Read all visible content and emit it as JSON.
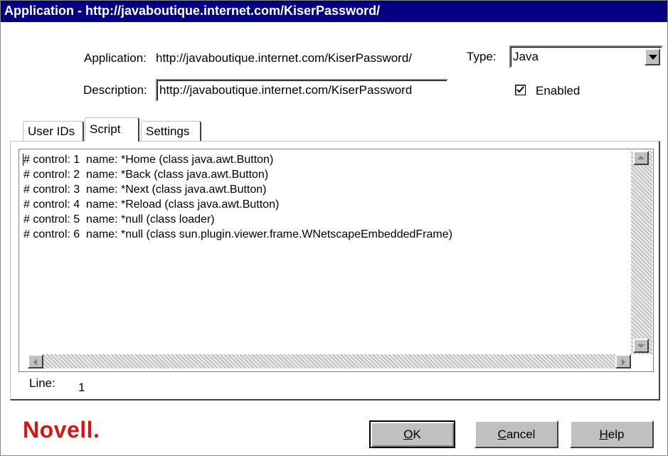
{
  "window": {
    "title": "Application - http://javaboutique.internet.com/KiserPassword/"
  },
  "form": {
    "application_label": "Application:",
    "application_value": "http://javaboutique.internet.com/KiserPassword/",
    "type_label": "Type:",
    "type_value": "Java",
    "description_label": "Description:",
    "description_value": "http://javaboutique.internet.com/KiserPassword",
    "enabled_label": "Enabled",
    "enabled_checked": true
  },
  "tabs": [
    {
      "label": "User IDs",
      "active": false
    },
    {
      "label": "Script",
      "active": true
    },
    {
      "label": "Settings",
      "active": false
    }
  ],
  "script": {
    "lines": [
      "# control: 1  name: *Home (class java.awt.Button)",
      "# control: 2  name: *Back (class java.awt.Button)",
      "# control: 3  name: *Next (class java.awt.Button)",
      "# control: 4  name: *Reload (class java.awt.Button)",
      "# control: 5  name: *null (class loader)",
      "# control: 6  name: *null (class sun.plugin.viewer.frame.WNetscapeEmbeddedFrame)"
    ],
    "line_label": "Line:",
    "line_value": "1"
  },
  "buttons": {
    "ok_prefix": "O",
    "ok_rest": "K",
    "cancel_prefix": "C",
    "cancel_rest": "ancel",
    "help_prefix": "H",
    "help_rest": "elp"
  },
  "brand": {
    "logo_text": "Novell.",
    "logo_color": "#d01818",
    "title_bar_color": "#000080"
  },
  "icons": {
    "dropdown": "chevron-down-icon",
    "scroll_up": "arrow-up-icon",
    "scroll_down": "arrow-down-icon",
    "scroll_left": "arrow-left-icon",
    "scroll_right": "arrow-right-icon",
    "checkbox": "checkmark-icon"
  }
}
